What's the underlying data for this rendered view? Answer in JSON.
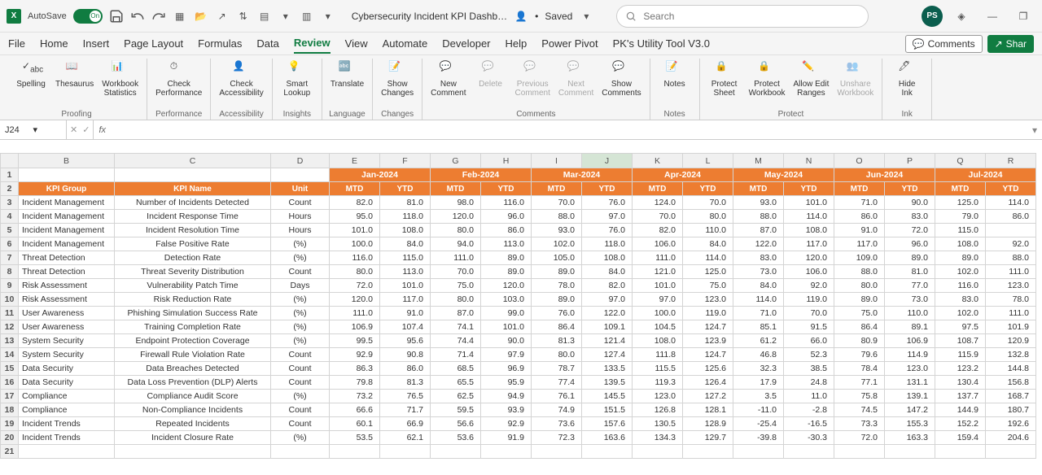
{
  "titlebar": {
    "autosave": "AutoSave",
    "toggle_state": "On",
    "doc_title": "Cybersecurity Incident KPI Dashb…",
    "saved": "Saved",
    "search_placeholder": "Search",
    "avatar": "PS"
  },
  "tabs": {
    "file": "File",
    "home": "Home",
    "insert": "Insert",
    "page_layout": "Page Layout",
    "formulas": "Formulas",
    "data": "Data",
    "review": "Review",
    "view": "View",
    "automate": "Automate",
    "developer": "Developer",
    "help": "Help",
    "power_pivot": "Power Pivot",
    "utility": "PK's Utility Tool V3.0",
    "comments": "Comments",
    "share": "Shar"
  },
  "ribbon": {
    "proofing": {
      "label": "Proofing",
      "spelling": "Spelling",
      "thesaurus": "Thesaurus",
      "stats": "Workbook\nStatistics"
    },
    "performance": {
      "label": "Performance",
      "check": "Check\nPerformance"
    },
    "accessibility": {
      "label": "Accessibility",
      "check": "Check\nAccessibility"
    },
    "insights": {
      "label": "Insights",
      "smart": "Smart\nLookup"
    },
    "language": {
      "label": "Language",
      "translate": "Translate"
    },
    "changes": {
      "label": "Changes",
      "show": "Show\nChanges"
    },
    "comments": {
      "label": "Comments",
      "new": "New\nComment",
      "delete": "Delete",
      "prev": "Previous\nComment",
      "next": "Next\nComment",
      "show": "Show\nComments"
    },
    "notes": {
      "label": "Notes",
      "notes": "Notes"
    },
    "protect": {
      "label": "Protect",
      "sheet": "Protect\nSheet",
      "workbook": "Protect\nWorkbook",
      "allow": "Allow Edit\nRanges",
      "unshare": "Unshare\nWorkbook"
    },
    "ink": {
      "label": "Ink",
      "hide": "Hide\nInk"
    }
  },
  "formula_bar": {
    "name": "J24",
    "value": ""
  },
  "columns": [
    "B",
    "C",
    "D",
    "E",
    "F",
    "G",
    "H",
    "I",
    "J",
    "K",
    "L",
    "M",
    "N",
    "O",
    "P",
    "Q",
    "R"
  ],
  "headers": {
    "group": "KPI Group",
    "kpi": "KPI Name",
    "unit": "Unit",
    "months": [
      "Jan-2024",
      "Feb-2024",
      "Mar-2024",
      "Apr-2024",
      "May-2024",
      "Jun-2024",
      "Jul-2024"
    ],
    "sub": [
      "MTD",
      "YTD"
    ]
  },
  "chart_data": {
    "type": "table",
    "rows": [
      {
        "group": "Incident Management",
        "kpi": "Number of Incidents Detected",
        "unit": "Count",
        "vals": [
          82.0,
          81.0,
          98.0,
          116.0,
          70.0,
          76.0,
          124.0,
          70.0,
          93.0,
          101.0,
          71.0,
          90.0,
          125.0,
          114.0
        ]
      },
      {
        "group": "Incident Management",
        "kpi": "Incident Response Time",
        "unit": "Hours",
        "vals": [
          95.0,
          118.0,
          120.0,
          96.0,
          88.0,
          97.0,
          70.0,
          80.0,
          88.0,
          114.0,
          86.0,
          83.0,
          79.0,
          86.0
        ]
      },
      {
        "group": "Incident Management",
        "kpi": "Incident Resolution Time",
        "unit": "Hours",
        "vals": [
          101.0,
          108.0,
          80.0,
          86.0,
          93.0,
          76.0,
          82.0,
          110.0,
          87.0,
          108.0,
          91.0,
          72.0,
          115.0,
          null
        ]
      },
      {
        "group": "Incident Management",
        "kpi": "False Positive Rate",
        "unit": "(%)",
        "vals": [
          100.0,
          84.0,
          94.0,
          113.0,
          102.0,
          118.0,
          106.0,
          84.0,
          122.0,
          117.0,
          117.0,
          96.0,
          108.0,
          92.0
        ]
      },
      {
        "group": "Threat Detection",
        "kpi": "Detection Rate",
        "unit": "(%)",
        "vals": [
          116.0,
          115.0,
          111.0,
          89.0,
          105.0,
          108.0,
          111.0,
          114.0,
          83.0,
          120.0,
          109.0,
          89.0,
          89.0,
          88.0
        ]
      },
      {
        "group": "Threat Detection",
        "kpi": "Threat Severity Distribution",
        "unit": "Count",
        "vals": [
          80.0,
          113.0,
          70.0,
          89.0,
          89.0,
          84.0,
          121.0,
          125.0,
          73.0,
          106.0,
          88.0,
          81.0,
          102.0,
          111.0
        ]
      },
      {
        "group": "Risk Assessment",
        "kpi": "Vulnerability Patch Time",
        "unit": "Days",
        "vals": [
          72.0,
          101.0,
          75.0,
          120.0,
          78.0,
          82.0,
          101.0,
          75.0,
          84.0,
          92.0,
          80.0,
          77.0,
          116.0,
          123.0
        ]
      },
      {
        "group": "Risk Assessment",
        "kpi": "Risk Reduction Rate",
        "unit": "(%)",
        "vals": [
          120.0,
          117.0,
          80.0,
          103.0,
          89.0,
          97.0,
          97.0,
          123.0,
          114.0,
          119.0,
          89.0,
          73.0,
          83.0,
          78.0
        ]
      },
      {
        "group": "User Awareness",
        "kpi": "Phishing Simulation Success Rate",
        "unit": "(%)",
        "vals": [
          111.0,
          91.0,
          87.0,
          99.0,
          76.0,
          122.0,
          100.0,
          119.0,
          71.0,
          70.0,
          75.0,
          110.0,
          102.0,
          111.0
        ]
      },
      {
        "group": "User Awareness",
        "kpi": "Training Completion Rate",
        "unit": "(%)",
        "vals": [
          106.9,
          107.4,
          74.1,
          101.0,
          86.4,
          109.1,
          104.5,
          124.7,
          85.1,
          91.5,
          86.4,
          89.1,
          97.5,
          101.9
        ]
      },
      {
        "group": "System Security",
        "kpi": "Endpoint Protection Coverage",
        "unit": "(%)",
        "vals": [
          99.5,
          95.6,
          74.4,
          90.0,
          81.3,
          121.4,
          108.0,
          123.9,
          61.2,
          66.0,
          80.9,
          106.9,
          108.7,
          120.9
        ]
      },
      {
        "group": "System Security",
        "kpi": "Firewall Rule Violation Rate",
        "unit": "Count",
        "vals": [
          92.9,
          90.8,
          71.4,
          97.9,
          80.0,
          127.4,
          111.8,
          124.7,
          46.8,
          52.3,
          79.6,
          114.9,
          115.9,
          132.8
        ]
      },
      {
        "group": "Data Security",
        "kpi": "Data Breaches Detected",
        "unit": "Count",
        "vals": [
          86.3,
          86.0,
          68.5,
          96.9,
          78.7,
          133.5,
          115.5,
          125.6,
          32.3,
          38.5,
          78.4,
          123.0,
          123.2,
          144.8
        ]
      },
      {
        "group": "Data Security",
        "kpi": "Data Loss Prevention (DLP) Alerts",
        "unit": "Count",
        "vals": [
          79.8,
          81.3,
          65.5,
          95.9,
          77.4,
          139.5,
          119.3,
          126.4,
          17.9,
          24.8,
          77.1,
          131.1,
          130.4,
          156.8
        ]
      },
      {
        "group": "Compliance",
        "kpi": "Compliance Audit Score",
        "unit": "(%)",
        "vals": [
          73.2,
          76.5,
          62.5,
          94.9,
          76.1,
          145.5,
          123.0,
          127.2,
          3.5,
          11.0,
          75.8,
          139.1,
          137.7,
          168.7
        ]
      },
      {
        "group": "Compliance",
        "kpi": "Non-Compliance Incidents",
        "unit": "Count",
        "vals": [
          66.6,
          71.7,
          59.5,
          93.9,
          74.9,
          151.5,
          126.8,
          128.1,
          -11.0,
          -2.8,
          74.5,
          147.2,
          144.9,
          180.7
        ]
      },
      {
        "group": "Incident Trends",
        "kpi": "Repeated Incidents",
        "unit": "Count",
        "vals": [
          60.1,
          66.9,
          56.6,
          92.9,
          73.6,
          157.6,
          130.5,
          128.9,
          -25.4,
          -16.5,
          73.3,
          155.3,
          152.2,
          192.6
        ]
      },
      {
        "group": "Incident Trends",
        "kpi": "Incident Closure Rate",
        "unit": "(%)",
        "vals": [
          53.5,
          62.1,
          53.6,
          91.9,
          72.3,
          163.6,
          134.3,
          129.7,
          -39.8,
          -30.3,
          72.0,
          163.3,
          159.4,
          204.6
        ]
      }
    ]
  }
}
